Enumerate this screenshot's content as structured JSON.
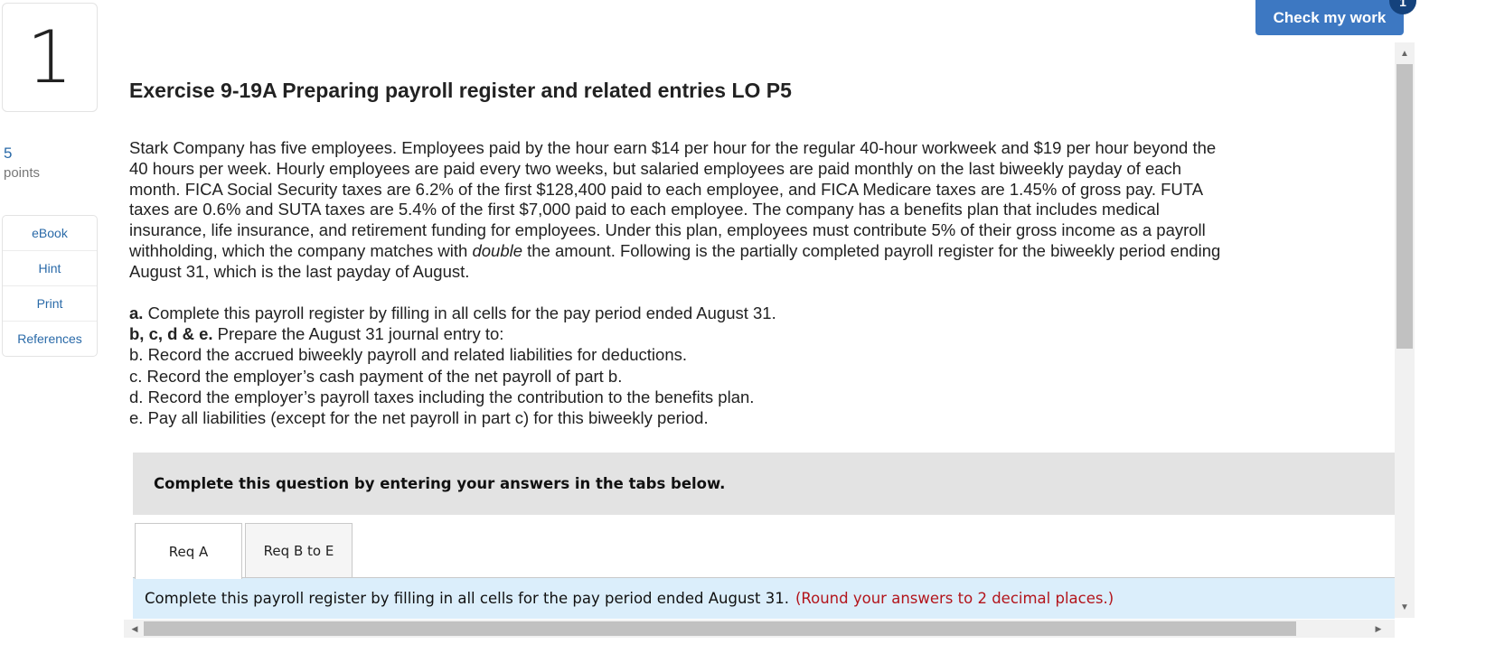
{
  "question": {
    "number": "1",
    "points_value": "5",
    "points_label": "points"
  },
  "sidebar": {
    "links": [
      {
        "label": "eBook"
      },
      {
        "label": "Hint"
      },
      {
        "label": "Print"
      },
      {
        "label": "References"
      }
    ]
  },
  "header": {
    "check_label": "Check my work",
    "check_badge": "1"
  },
  "exercise": {
    "title": "Exercise 9-19A Preparing payroll register and related entries LO P5",
    "intro_before_double": "Stark Company has five employees. Employees paid by the hour earn $14 per hour for the regular 40-hour workweek and $19 per hour beyond the 40 hours per week. Hourly employees are paid every two weeks, but salaried employees are paid monthly on the last biweekly payday of each month. FICA Social Security taxes are 6.2% of the first $128,400 paid to each employee, and FICA Medicare taxes are 1.45% of gross pay. FUTA taxes are 0.6% and SUTA taxes are 5.4% of the first $7,000 paid to each employee. The company has a benefits plan that includes medical insurance, life insurance, and retirement funding for employees. Under this plan, employees must contribute 5% of their gross income as a payroll withholding, which the company matches with",
    "intro_emph": "double",
    "intro_after_double": "the amount. Following is the partially completed payroll register for the biweekly period ending August 31, which is the last payday of August.",
    "task_a_label": "a.",
    "task_a_text": "Complete this payroll register by filling in all cells for the pay period ended August 31.",
    "task_bcde_label": "b, c, d & e.",
    "task_bcde_text": "Prepare the August 31 journal entry to:",
    "task_b": "b. Record the accrued biweekly payroll and related liabilities for deductions.",
    "task_c": "c. Record the employer’s cash payment of the net payroll of part b.",
    "task_d": "d. Record the employer’s payroll taxes including the contribution to the benefits plan.",
    "task_e": "e. Pay all liabilities (except for the net payroll in part c) for this biweekly period."
  },
  "instructions": {
    "box_text": "Complete this question by entering your answers in the tabs below."
  },
  "tabs": [
    {
      "label": "Req A",
      "active": true
    },
    {
      "label": "Req B to E",
      "active": false
    }
  ],
  "req_a": {
    "instruction": "Complete this payroll register by filling in all cells for the pay period ended August 31.",
    "rounding_note": "(Round your answers to 2 decimal places.)"
  },
  "colors": {
    "accent": "#3d78c2",
    "badge": "#14427c",
    "link": "#2a6aa8",
    "note_red": "#b3151c",
    "req_bg": "#dbeefb"
  }
}
